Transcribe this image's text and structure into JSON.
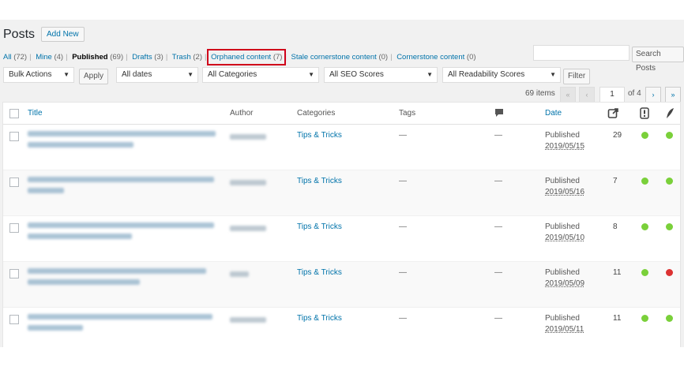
{
  "page": {
    "title": "Posts",
    "add_new": "Add New"
  },
  "search": {
    "button": "Search Posts",
    "value": ""
  },
  "views": [
    {
      "label": "All",
      "count": "(72)"
    },
    {
      "label": "Mine",
      "count": "(4)"
    },
    {
      "label": "Published",
      "count": "(69)"
    },
    {
      "label": "Drafts",
      "count": "(3)"
    },
    {
      "label": "Trash",
      "count": "(2)"
    },
    {
      "label": "Orphaned content",
      "count": "(7)"
    },
    {
      "label": "Stale cornerstone content",
      "count": "(0)"
    },
    {
      "label": "Cornerstone content",
      "count": "(0)"
    }
  ],
  "filters": {
    "bulk_actions": "Bulk Actions",
    "apply": "Apply",
    "dates": "All dates",
    "categories": "All Categories",
    "seo": "All SEO Scores",
    "readability": "All Readability Scores",
    "filter": "Filter"
  },
  "pagination": {
    "items": "69 items",
    "first": "«",
    "prev": "‹",
    "current": "1",
    "of": "of 4",
    "next": "›",
    "last": "»"
  },
  "columns": {
    "title": "Title",
    "author": "Author",
    "categories": "Categories",
    "tags": "Tags",
    "date": "Date"
  },
  "icons": {
    "comments": "comment-bubble-icon",
    "links": "outgoing-links-icon",
    "seo": "seo-score-icon",
    "readability": "readability-icon"
  },
  "colors": {
    "green": "#7ad03a",
    "red": "#dc3232",
    "link": "#0073aa"
  },
  "rows": [
    {
      "category": "Tips & Tricks",
      "tags": "—",
      "comments": "—",
      "status": "Published",
      "date": "2019/05/15",
      "links": "29",
      "seo": "#7ad03a",
      "readability": "#7ad03a"
    },
    {
      "category": "Tips & Tricks",
      "tags": "—",
      "comments": "—",
      "status": "Published",
      "date": "2019/05/16",
      "links": "7",
      "seo": "#7ad03a",
      "readability": "#7ad03a"
    },
    {
      "category": "Tips & Tricks",
      "tags": "—",
      "comments": "—",
      "status": "Published",
      "date": "2019/05/10",
      "links": "8",
      "seo": "#7ad03a",
      "readability": "#7ad03a"
    },
    {
      "category": "Tips & Tricks",
      "tags": "—",
      "comments": "—",
      "status": "Published",
      "date": "2019/05/09",
      "links": "11",
      "seo": "#7ad03a",
      "readability": "#dc3232"
    },
    {
      "category": "Tips & Tricks",
      "tags": "—",
      "comments": "—",
      "status": "Published",
      "date": "2019/05/11",
      "links": "11",
      "seo": "#7ad03a",
      "readability": "#7ad03a"
    }
  ]
}
